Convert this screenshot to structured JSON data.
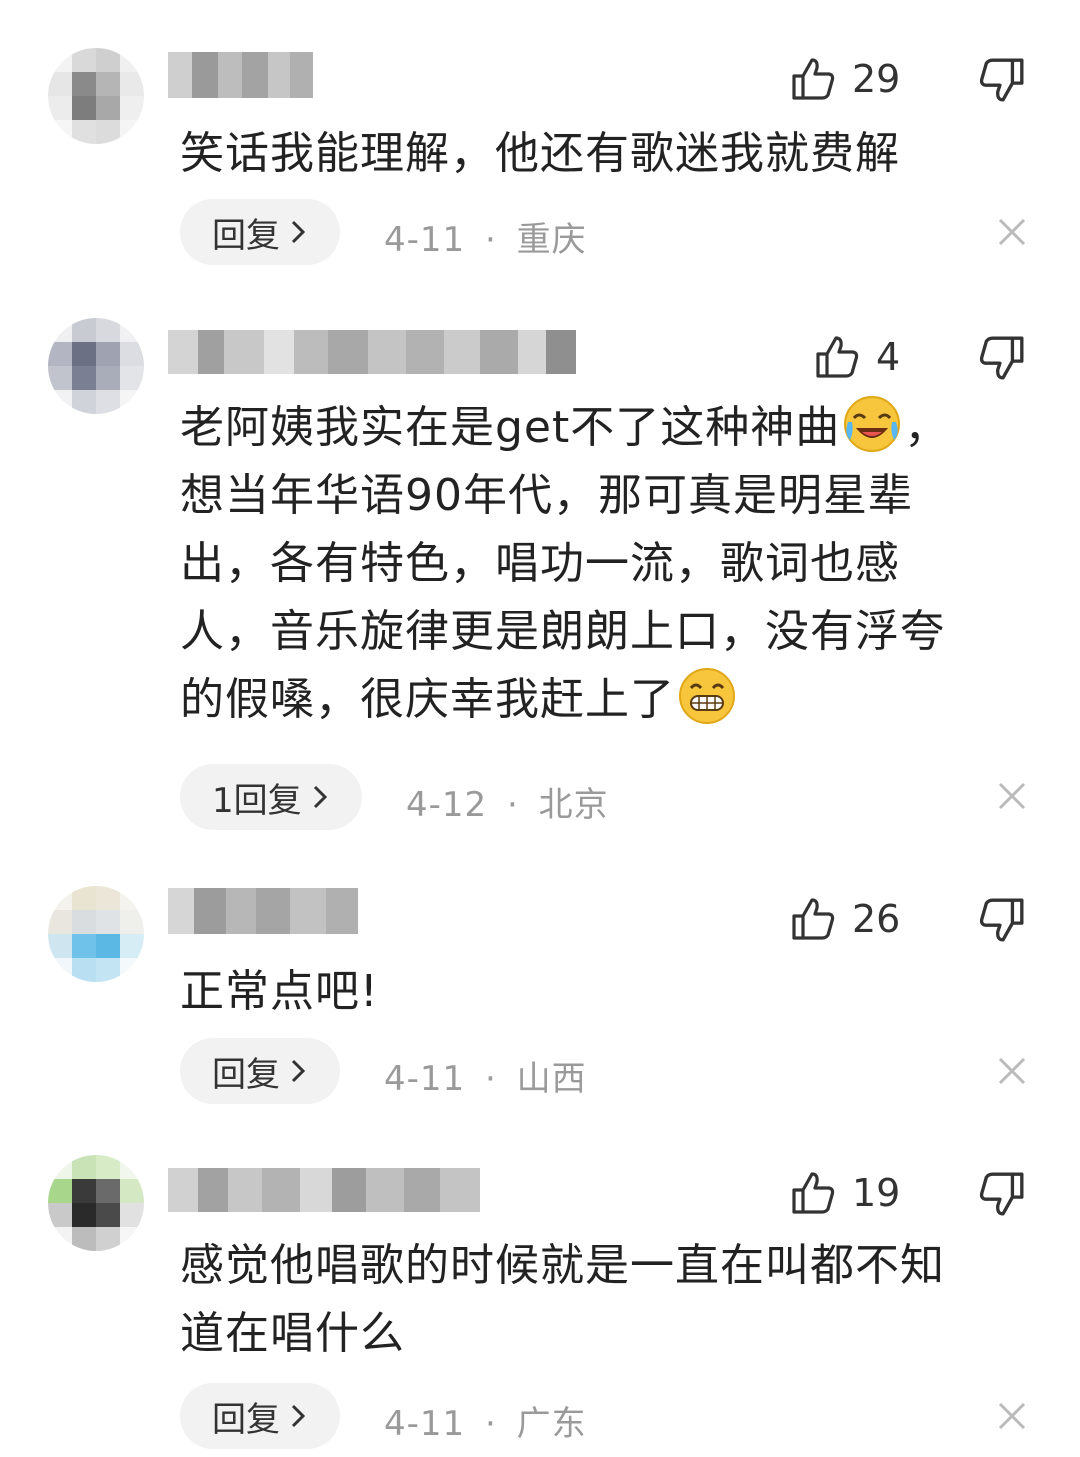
{
  "comments": [
    {
      "likes": "29",
      "text_lines": [
        "笑话我能理解，他还有歌迷我就费解"
      ],
      "reply_label": "回复",
      "date": "4-11",
      "location": "重庆",
      "separator": "·"
    },
    {
      "likes": "4",
      "text_lines": [
        "老阿姨我实在是get不了这种神曲",
        "想当年华语90年代，那可真是明星辈",
        "出，各有特色，唱功一流，歌词也感",
        "人，音乐旋律更是朗朗上口，没有浮夸",
        "的假嗓，很庆幸我赶上了"
      ],
      "line1_suffix": "，",
      "reply_label": "1回复",
      "date": "4-12",
      "location": "北京",
      "separator": "·"
    },
    {
      "likes": "26",
      "text_lines": [
        "正常点吧!"
      ],
      "reply_label": "回复",
      "date": "4-11",
      "location": "山西",
      "separator": "·"
    },
    {
      "likes": "19",
      "text_lines": [
        "感觉他唱歌的时候就是一直在叫都不知",
        "道在唱什么"
      ],
      "reply_label": "回复",
      "date": "4-11",
      "location": "广东",
      "separator": "·"
    }
  ],
  "icons": {
    "like": "thumbs-up-icon",
    "dislike": "thumbs-down-icon",
    "close": "close-icon",
    "chevron": "chevron-right-icon",
    "emoji_laugh_cry": "rolling-laughing-emoji",
    "emoji_grin": "grinning-emoji"
  },
  "colors": {
    "pill_bg": "#f2f2f2",
    "meta_gray": "#9a9a9a",
    "text": "#222222"
  }
}
